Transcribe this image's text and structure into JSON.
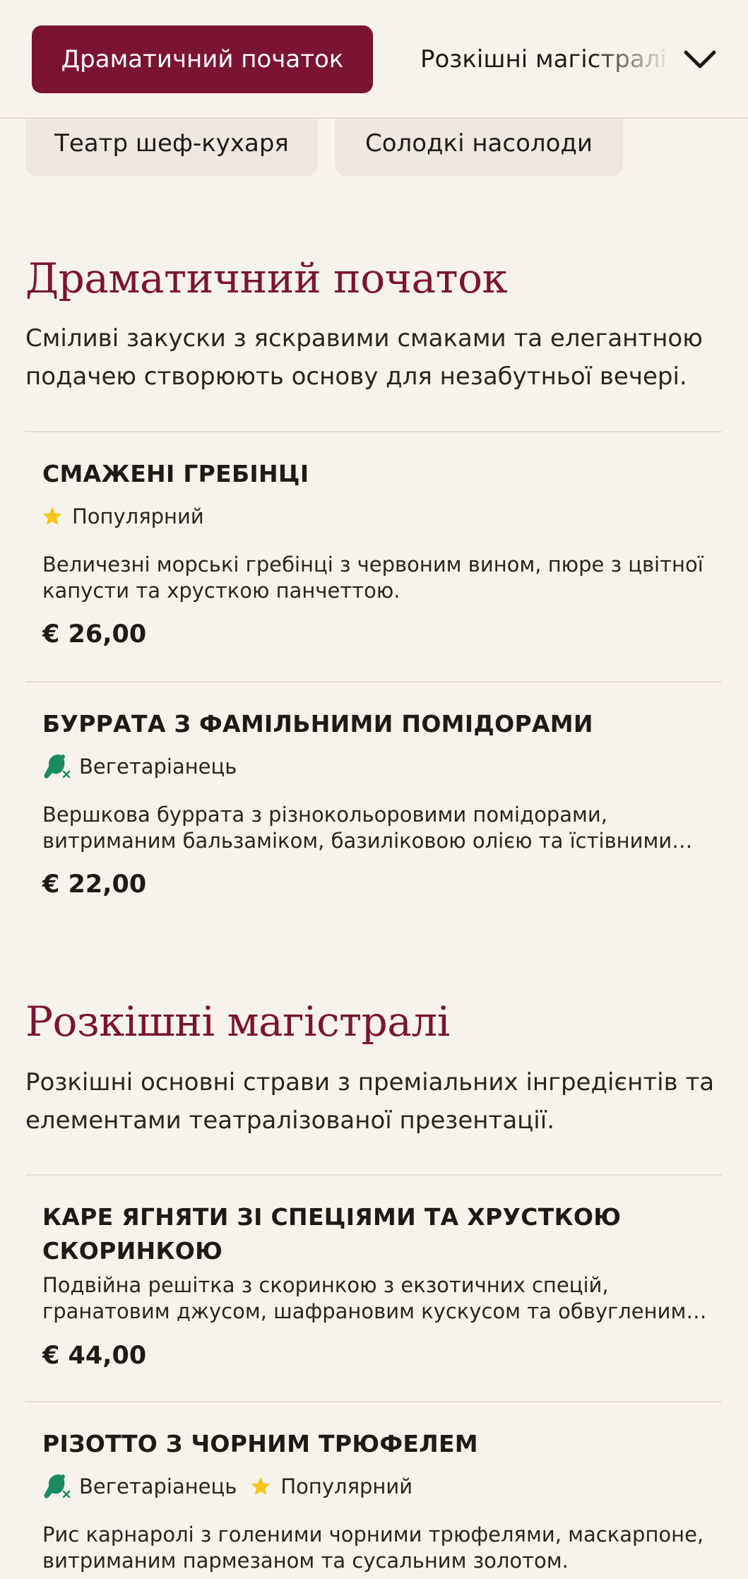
{
  "nav": {
    "active_tab": "Драматичний початок",
    "next_tab": "Розкішні магістралі",
    "chips": [
      "Театр шеф-кухаря",
      "Солодкі насолоди"
    ]
  },
  "tag_labels": {
    "popular": "Популярний",
    "vegetarian": "Вегетаріанець"
  },
  "colors": {
    "accent": "#7b1432",
    "star": "#f5c518",
    "veg": "#1a8a63"
  },
  "sections": [
    {
      "title": "Драматичний початок",
      "description": "Сміливі закуски з яскравими смаками та елегантною подачею створюють основу для незабутньої вечері.",
      "items": [
        {
          "name": "СМАЖЕНІ ГРЕБІНЦІ",
          "description": "Величезні морські гребінці з червоним вином, пюре з цвітної капусти та хрусткою панчеттою.",
          "price": "€ 26,00"
        },
        {
          "name": "БУРРАТА З ФАМІЛЬНИМИ ПОМІДОРАМИ",
          "description": "Вершкова буррата з різнокольоровими помідорами, витриманим бальзаміком, базиліковою олією та їстівними квітами.",
          "price": "€ 22,00"
        }
      ]
    },
    {
      "title": "Розкішні магістралі",
      "description": "Розкішні основні страви з преміальних інгредієнтів та елементами театралізованої презентації.",
      "items": [
        {
          "name": "КАРЕ ЯГНЯТИ ЗІ СПЕЦІЯМИ ТА ХРУСТКОЮ СКОРИНКОЮ",
          "description": "Подвійна решітка з скоринкою з екзотичних спецій, гранатовим джусом, шафрановим кускусом та обвугленими овочами.",
          "price": "€ 44,00"
        },
        {
          "name": "РІЗОТТО З ЧОРНИМ ТРЮФЕЛЕМ",
          "description": "Рис карнаролі з голеними чорними трюфелями, маскарпоне, витриманим пармезаном та сусальним золотом."
        }
      ]
    }
  ]
}
